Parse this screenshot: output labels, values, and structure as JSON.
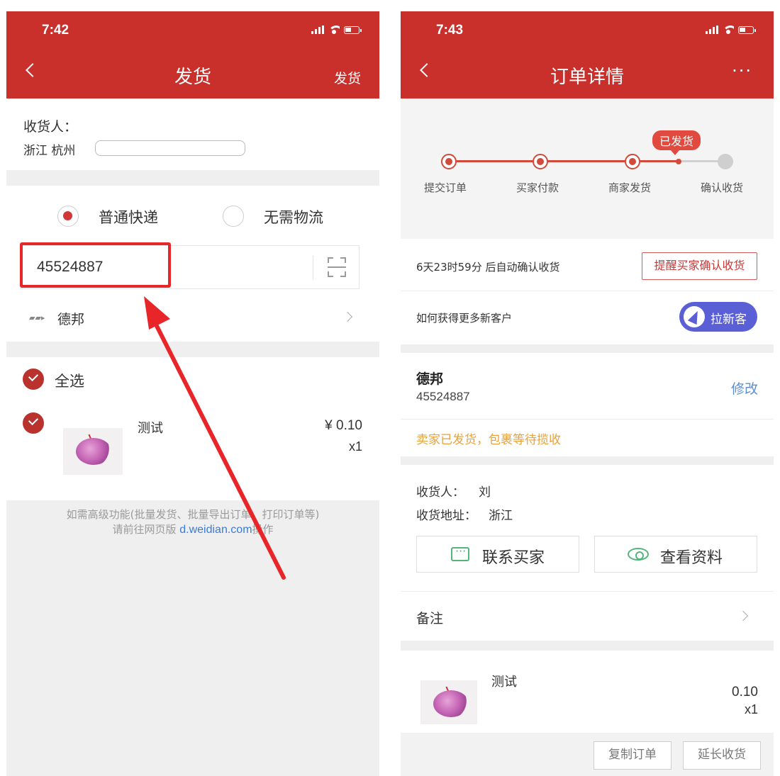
{
  "left": {
    "status_time": "7:42",
    "title": "发货",
    "nav_right": "发货",
    "recipient_label": "收货人：",
    "address_label": "浙江 杭州",
    "shipping_options": [
      {
        "label": "普通快递",
        "checked": true
      },
      {
        "label": "无需物流",
        "checked": false
      }
    ],
    "tracking_number": "45524887",
    "courier": "德邦",
    "select_all": "全选",
    "item": {
      "name": "测试",
      "price": "¥ 0.10",
      "qty": "x1"
    },
    "footer_line1": "如需高级功能(批量发货、批量导出订单、打印订单等)",
    "footer_line2_prefix": "请前往网页版",
    "footer_link": "d.weidian.com",
    "footer_line2_suffix": "操作"
  },
  "right": {
    "status_time": "7:43",
    "title": "订单详情",
    "more": "···",
    "steps": [
      "提交订单",
      "买家付款",
      "商家发货",
      "确认收货"
    ],
    "current_tag": "已发货",
    "countdown": "6天23时59分 后自动确认收货",
    "remind_button": "提醒买家确认收货",
    "new_customer_text": "如何获得更多新客户",
    "new_customer_button": "拉新客",
    "courier": "德邦",
    "tracking_number": "45524887",
    "edit": "修改",
    "shipped_notice": "卖家已发货，包裹等待揽收",
    "recipient_label": "收货人：",
    "recipient_name": "刘",
    "address_label": "收货地址：",
    "address_value": "浙江",
    "contact_button": "联系买家",
    "view_button": "查看资料",
    "remark": "备注",
    "item": {
      "name": "测试",
      "price": "0.10",
      "qty": "x1"
    },
    "copy_button": "复制订单",
    "extend_button": "延长收货"
  },
  "colors": {
    "brand_red": "#c9302c",
    "highlight": "#e8262a",
    "link": "#3a7bd5",
    "accent_purple": "#5b5fd6",
    "notice_orange": "#e6a23c"
  }
}
